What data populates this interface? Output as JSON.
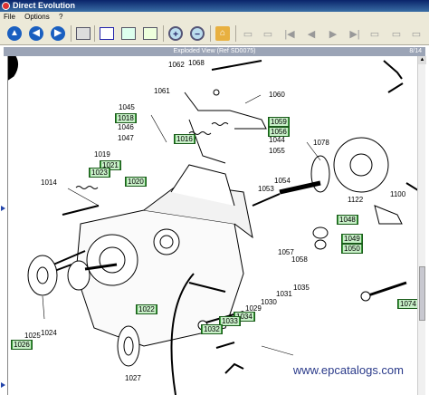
{
  "window": {
    "title": "Direct Evolution"
  },
  "menu": [
    "File",
    "Options",
    "?"
  ],
  "view": {
    "caption": "Exploded View (Ref SD0075)",
    "page": "8/14"
  },
  "labels": {
    "l1062": "1062",
    "l1068": "1068",
    "l1061": "1061",
    "l1060": "1060",
    "l1045": "1045",
    "l1046": "1046",
    "l1047": "1047",
    "l1019": "1019",
    "l1014": "1014",
    "l1044": "1044",
    "l1055": "1055",
    "l1078": "1078",
    "l1054": "1054",
    "l1053": "1053",
    "l1122": "1122",
    "l1100": "1100",
    "l1057": "1057",
    "l1058": "1058",
    "l1035": "1035",
    "l1031": "1031",
    "l1030": "1030",
    "l1029": "1029",
    "l1025": "1025",
    "l1024": "1024",
    "l1027": "1027",
    "l1011": "1011"
  },
  "tags": {
    "t1018": "1018",
    "t1016": "1016",
    "t1059": "1059",
    "t1056": "1056",
    "t1021": "1021",
    "t1023": "1023",
    "t1020": "1020",
    "t1048": "1048",
    "t1049": "1049",
    "t1050": "1050",
    "t1022": "1022",
    "t1034": "1034",
    "t1033": "1033",
    "t1032": "1032",
    "t1026": "1026",
    "t1074": "1074"
  },
  "watermark": "www.epcatalogs.com",
  "icons": [
    "up-icon",
    "back-icon",
    "forward-icon",
    "print-icon",
    "fit-icon",
    "page-icon",
    "zoom-in-icon",
    "zoom-out-icon",
    "home-icon"
  ]
}
